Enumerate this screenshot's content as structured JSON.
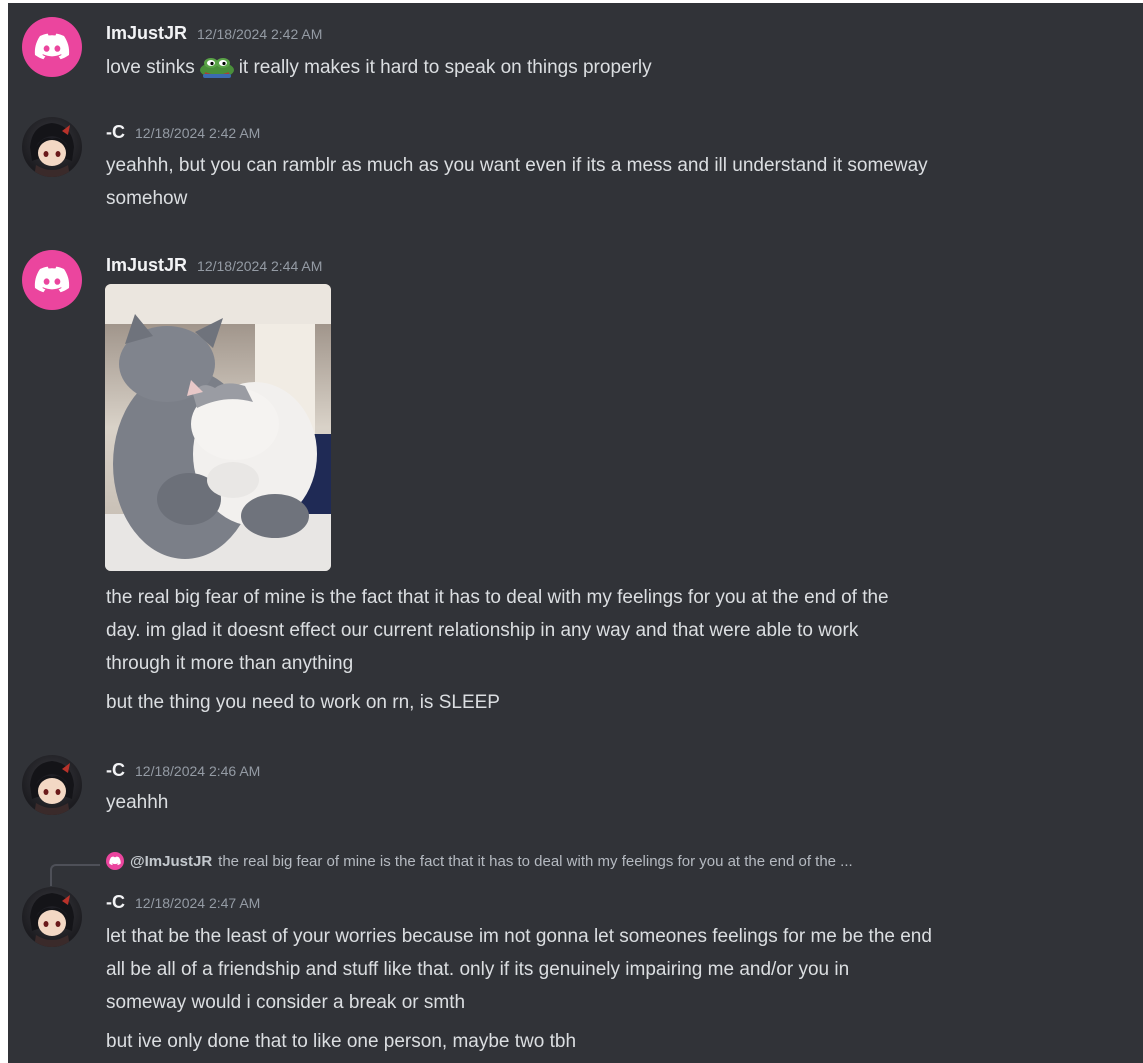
{
  "messages": [
    {
      "username": "ImJustJR",
      "timestamp": "12/18/2024 2:42 AM",
      "avatar_icon": "discord-logo-icon",
      "text_before_emoji": "love stinks",
      "emoji": "pepe-emoji-icon",
      "text_after_emoji": "it really makes it hard to speak on things properly"
    },
    {
      "username": "-C",
      "timestamp": "12/18/2024 2:42 AM",
      "avatar_icon": "anime-avatar",
      "lines": [
        "yeahhh, but you can ramblr as much as you want even if its a mess and ill understand it someway",
        "somehow"
      ]
    },
    {
      "username": "ImJustJR",
      "timestamp": "12/18/2024 2:44 AM",
      "avatar_icon": "discord-logo-icon",
      "attachment": "cat-hug-gif",
      "paragraph1": [
        "the real big fear of mine is the fact that it has to deal with my feelings for you at the end of the",
        "day. im glad it doesnt effect our current relationship in any way and that were able to work",
        "through it more than anything"
      ],
      "paragraph2": "but the thing you need to work on rn, is SLEEP"
    },
    {
      "username": "-C",
      "timestamp": "12/18/2024 2:46 AM",
      "avatar_icon": "anime-avatar",
      "text": "yeahhh"
    },
    {
      "username": "-C",
      "timestamp": "12/18/2024 2:47 AM",
      "avatar_icon": "anime-avatar",
      "reply": {
        "mention": "@ImJustJR",
        "preview": "the real big fear of mine is the fact that it has to deal with my feelings for you at the end of the ..."
      },
      "paragraph1": [
        "let that be the least of your worries because im not gonna let someones feelings for me be the end",
        "all be all of a friendship and stuff like that. only if its genuinely impairing me and/or you in",
        "someway would i consider a break or smth"
      ],
      "paragraph2": "but ive only done that to like one person, maybe two tbh"
    }
  ],
  "colors": {
    "background": "#313338",
    "username": "#f2f3f5",
    "timestamp": "#949ba4",
    "text": "#dbdee1",
    "discord_pink": "#eb459e"
  }
}
